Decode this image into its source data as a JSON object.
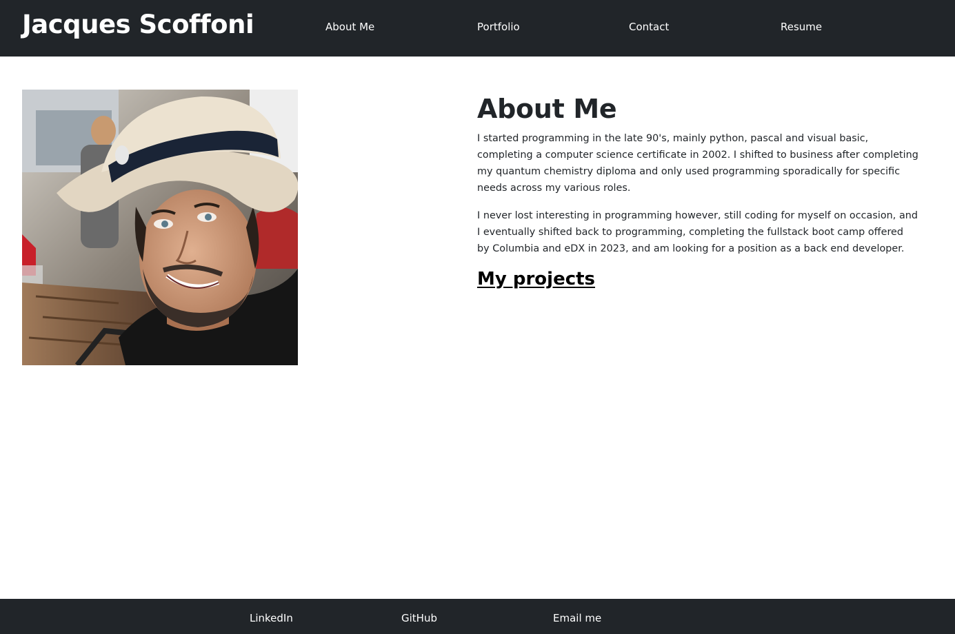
{
  "header": {
    "brand": "Jacques Scoffoni",
    "nav": [
      "About Me",
      "Portfolio",
      "Contact",
      "Resume"
    ]
  },
  "main": {
    "heading": "About Me",
    "paragraphs": [
      "I started programming in the late 90's, mainly python, pascal and visual basic, completing a computer science certificate in 2002. I shifted to business after completing my quantum chemistry diploma and only used programming sporadically for specific needs across my various roles.",
      "I never lost interesting in programming however, still coding for myself on occasion, and I eventually shifted back to programming, completing the fullstack boot camp offered by Columbia and eDX in 2023, and am looking for a position as a back end developer."
    ],
    "projects_link": "My projects"
  },
  "footer": {
    "links": [
      "LinkedIn",
      "GitHub",
      "Email me"
    ]
  },
  "colors": {
    "bar_background": "#212529",
    "page_background": "#ffffff",
    "text": "#212529",
    "bar_text": "#ffffff"
  }
}
